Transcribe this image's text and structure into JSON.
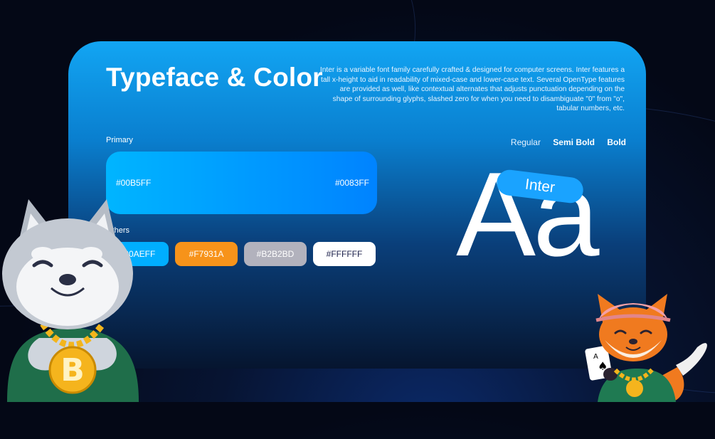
{
  "header": {
    "title": "Typeface & Color",
    "description": "Inter is a variable font family carefully crafted & designed for computer screens. Inter features a tall x-height to aid in readability of mixed-case and lower-case text. Several OpenType features are provided as well, like contextual alternates that adjusts punctuation depending on the shape of surrounding glyphs, slashed zero for when you need to disambiguate \"0\" from \"o\", tabular numbers, etc."
  },
  "primary": {
    "label": "Primary",
    "start_hex": "#00B5FF",
    "end_hex": "#0083FF"
  },
  "others": {
    "label": "Others",
    "chips": [
      {
        "hex": "#00AEFF",
        "color": "#00AEFF",
        "text_color": "#ffffff"
      },
      {
        "hex": "#F7931A",
        "color": "#F7931A",
        "text_color": "#ffffff"
      },
      {
        "hex": "#B2B2BD",
        "color": "#B2B2BD",
        "text_color": "#ffffff"
      },
      {
        "hex": "#FFFFFF",
        "color": "#FFFFFF",
        "text_color": "#1b1f4a"
      }
    ]
  },
  "typeface": {
    "weights": [
      "Regular",
      "Semi Bold",
      "Bold"
    ],
    "sample": "Aa",
    "font_name": "Inter"
  }
}
